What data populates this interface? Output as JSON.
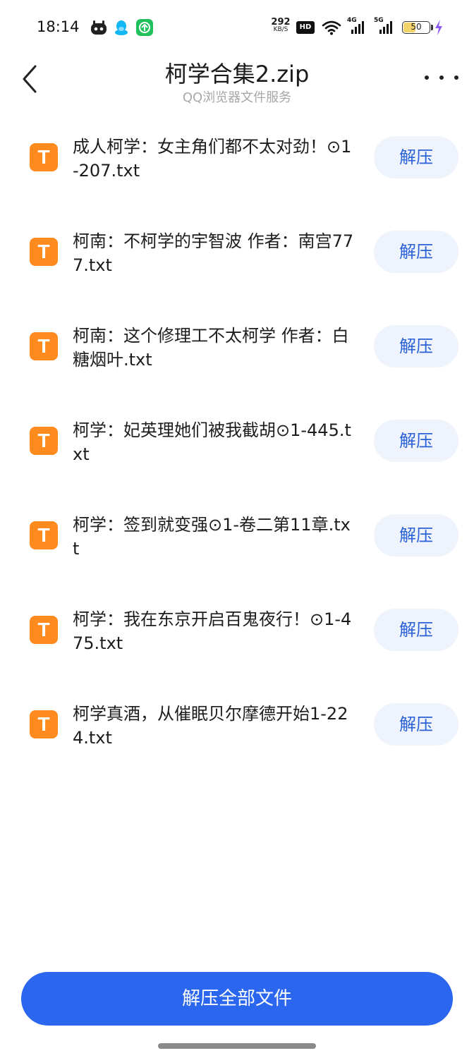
{
  "status_bar": {
    "time": "18:14",
    "app_icons": [
      "robot-app-icon",
      "qq-penguin-icon",
      "green-upload-app-icon"
    ],
    "net_speed_value": "292",
    "net_speed_unit": "KB/S",
    "hd_badge": "HD",
    "signal_1_label": "4G",
    "signal_2_label": "5G",
    "battery_level": "50",
    "battery_fraction": 0.5
  },
  "header": {
    "title": "柯学合集2.zip",
    "subtitle": "QQ浏览器文件服务",
    "back_icon": "chevron-left-icon",
    "more_icon": "more-horizontal-icon"
  },
  "files": [
    {
      "icon_letter": "T",
      "name": "成人柯学：女主角们都不太对劲！⊙1-207.txt",
      "action": "解压"
    },
    {
      "icon_letter": "T",
      "name": "柯南：不柯学的宇智波 作者：南宫777.txt",
      "action": "解压"
    },
    {
      "icon_letter": "T",
      "name": "柯南：这个修理工不太柯学 作者：白糖烟叶.txt",
      "action": "解压"
    },
    {
      "icon_letter": "T",
      "name": "柯学：妃英理她们被我截胡⊙1-445.txt",
      "action": "解压"
    },
    {
      "icon_letter": "T",
      "name": "柯学：签到就变强⊙1-卷二第11章.txt",
      "action": "解压"
    },
    {
      "icon_letter": "T",
      "name": "柯学：我在东京开启百鬼夜行！⊙1-475.txt",
      "action": "解压"
    },
    {
      "icon_letter": "T",
      "name": "柯学真酒，从催眠贝尔摩德开始1-224.txt",
      "action": "解压"
    }
  ],
  "footer": {
    "extract_all_label": "解压全部文件"
  },
  "colors": {
    "accent": "#2b66ef",
    "extract_button_bg": "#eef3fc",
    "extract_button_text": "#2a61d8",
    "file_icon": "#ff8a1e",
    "battery_fill": "#f3d46b",
    "charging_bolt": "#8f5bf5"
  }
}
